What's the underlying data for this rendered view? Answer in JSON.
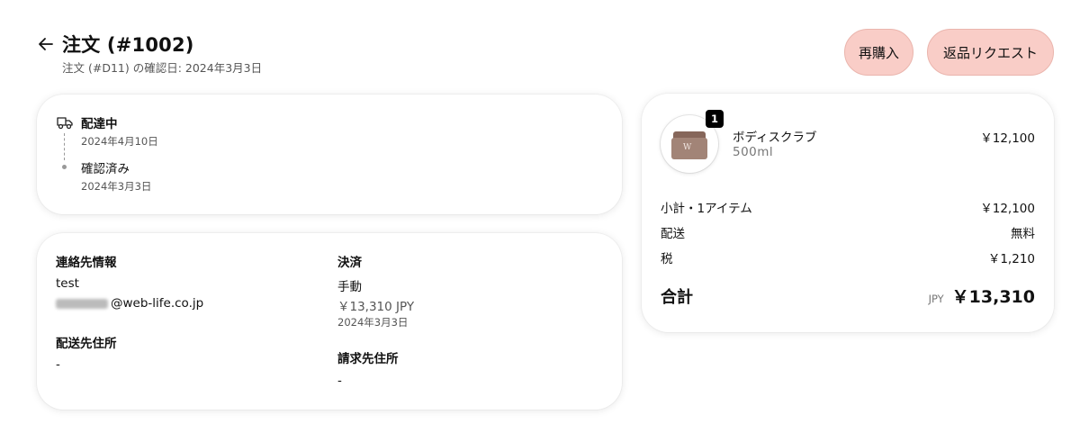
{
  "header": {
    "title": "注文 (#1002)",
    "subtitle": "注文 (#D11) の確認日: 2024年3月3日"
  },
  "actions": {
    "reorder_label": "再購入",
    "return_label": "返品リクエスト"
  },
  "status": {
    "current_label": "配達中",
    "current_date": "2024年4月10日",
    "previous_label": "確認済み",
    "previous_date": "2024年3月3日"
  },
  "contact": {
    "title": "連絡先情報",
    "name": "test",
    "email_visible": "@web-life.co.jp"
  },
  "shipping_address": {
    "title": "配送先住所",
    "value": "-"
  },
  "payment": {
    "title": "決済",
    "method": "手動",
    "amount": "￥13,310 JPY",
    "date": "2024年3月3日"
  },
  "billing_address": {
    "title": "請求先住所",
    "value": "-"
  },
  "product": {
    "quantity": "1",
    "name": "ボディスクラブ",
    "variant": "500ml",
    "price": "￥12,100",
    "logo_text": "W"
  },
  "summary": {
    "subtotal_label": "小計・1アイテム",
    "subtotal_value": "￥12,100",
    "shipping_label": "配送",
    "shipping_value": "無料",
    "tax_label": "税",
    "tax_value": "￥1,210",
    "total_label": "合計",
    "currency": "JPY",
    "total_value": "￥13,310"
  },
  "colors": {
    "button_bg": "#f9cdc7",
    "text": "#111111",
    "muted": "#555555"
  },
  "icons": [
    "back-arrow-icon",
    "truck-icon"
  ]
}
